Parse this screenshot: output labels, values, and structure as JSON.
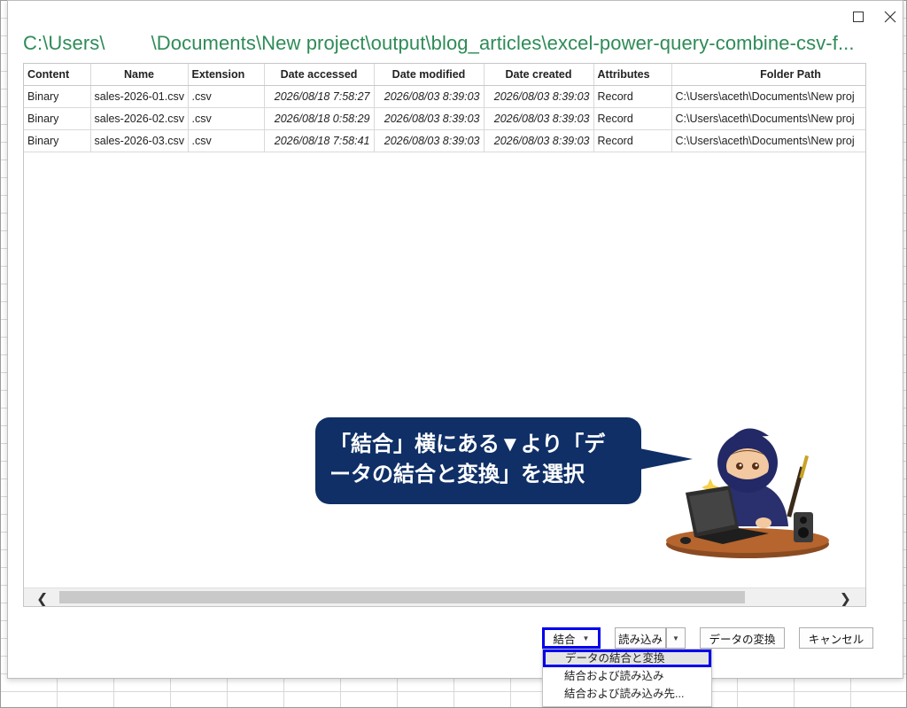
{
  "dialog": {
    "title_part1": "C:\\Users\\",
    "title_part2": "\\Documents\\New project\\output\\blog_articles\\excel-power-query-combine-csv-f..."
  },
  "table": {
    "columns": [
      "Content",
      "Name",
      "Extension",
      "Date accessed",
      "Date modified",
      "Date created",
      "Attributes",
      "Folder Path"
    ],
    "rows": [
      [
        "Binary",
        "sales-2026-01.csv",
        ".csv",
        "2026/08/18 7:58:27",
        "2026/08/03 8:39:03",
        "2026/08/03 8:39:03",
        "Record",
        "C:\\Users\\aceth\\Documents\\New proj"
      ],
      [
        "Binary",
        "sales-2026-02.csv",
        ".csv",
        "2026/08/18 0:58:29",
        "2026/08/03 8:39:03",
        "2026/08/03 8:39:03",
        "Record",
        "C:\\Users\\aceth\\Documents\\New proj"
      ],
      [
        "Binary",
        "sales-2026-03.csv",
        ".csv",
        "2026/08/18 7:58:41",
        "2026/08/03 8:39:03",
        "2026/08/03 8:39:03",
        "Record",
        "C:\\Users\\aceth\\Documents\\New proj"
      ]
    ]
  },
  "buttons": {
    "combine": "結合",
    "load": "読み込み",
    "transform": "データの変換",
    "cancel": "キャンセル"
  },
  "dropdown": {
    "items": [
      "データの結合と変換",
      "結合および読み込み",
      "結合および読み込み先..."
    ]
  },
  "callout": {
    "line1": "「結合」横にある▼より「デ",
    "line2": "ータの結合と変換」を選択"
  },
  "colors": {
    "title_green": "#2e8b57",
    "highlight_blue": "#0000ee",
    "callout_navy": "#0f2f66"
  }
}
